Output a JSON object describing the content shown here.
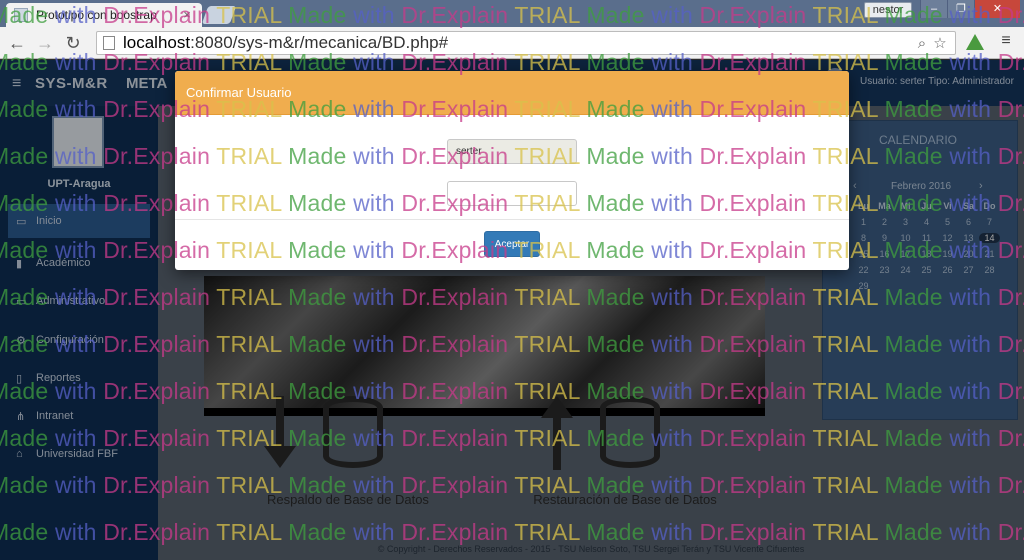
{
  "browser": {
    "tab_title": "Prototipo con boostrap",
    "user_badge": "nestor",
    "url_host": "localhost",
    "url_rest": ":8080/sys-m&r/mecanica/BD.php#",
    "icons": {
      "back": "arrow-left-icon",
      "forward": "arrow-right-icon",
      "reload": "reload-icon",
      "zoom": "zoom-icon",
      "bookmark": "star-icon",
      "extension": "google-drive-icon",
      "menu": "hamburger-menu-icon"
    }
  },
  "app": {
    "brand": "SYS-M&R",
    "brand_secondary": "META",
    "user_info": "Usuario: serter   Tipo: Administrador",
    "logo_label": "UPT-Aragua",
    "sidebar": [
      {
        "label": "Inicio",
        "icon": "folder-open-icon",
        "active": true
      },
      {
        "label": "Académico",
        "icon": "book-icon"
      },
      {
        "label": "Administrativo",
        "icon": "desktop-icon"
      },
      {
        "label": "Configuración",
        "icon": "cogs-icon"
      },
      {
        "label": "Reportes",
        "icon": "file-icon"
      },
      {
        "label": "Intranet",
        "icon": "sitemap-icon"
      },
      {
        "label": "Universidad FBF",
        "icon": "institution-icon"
      }
    ],
    "backup_label": "Respaldo de Base de Datos",
    "restore_label": "Restauración de Base de Datos",
    "footer": "© Copyright - Derechos Reservados - 2015 - TSU Nelson Soto, TSU Sergei Terán y TSU Vicente Cifuentes",
    "calendar": {
      "title": "CALENDARIO",
      "month": "Febrero 2016",
      "weekdays": [
        "Lu",
        "Ma",
        "Mi",
        "Ju",
        "Vi",
        "Sa",
        "Do"
      ],
      "days": [
        "1",
        "2",
        "3",
        "4",
        "5",
        "6",
        "7",
        "8",
        "9",
        "10",
        "11",
        "12",
        "13",
        "14",
        "15",
        "16",
        "17",
        "18",
        "19",
        "20",
        "21",
        "22",
        "23",
        "24",
        "25",
        "26",
        "27",
        "28",
        "29"
      ],
      "today": "14"
    }
  },
  "modal": {
    "title": "Confirmar Usuario",
    "username_value": "serter",
    "password_value": "",
    "accept_label": "Aceptar"
  },
  "watermark": {
    "words": [
      "Made",
      "with",
      "Dr.Explain",
      "TRIAL"
    ]
  },
  "colors": {
    "modal_header": "#f0ad4e",
    "accept_button": "#337ab7",
    "nav_bg": "#14375f",
    "sidebar_bg": "#0f2f55"
  }
}
